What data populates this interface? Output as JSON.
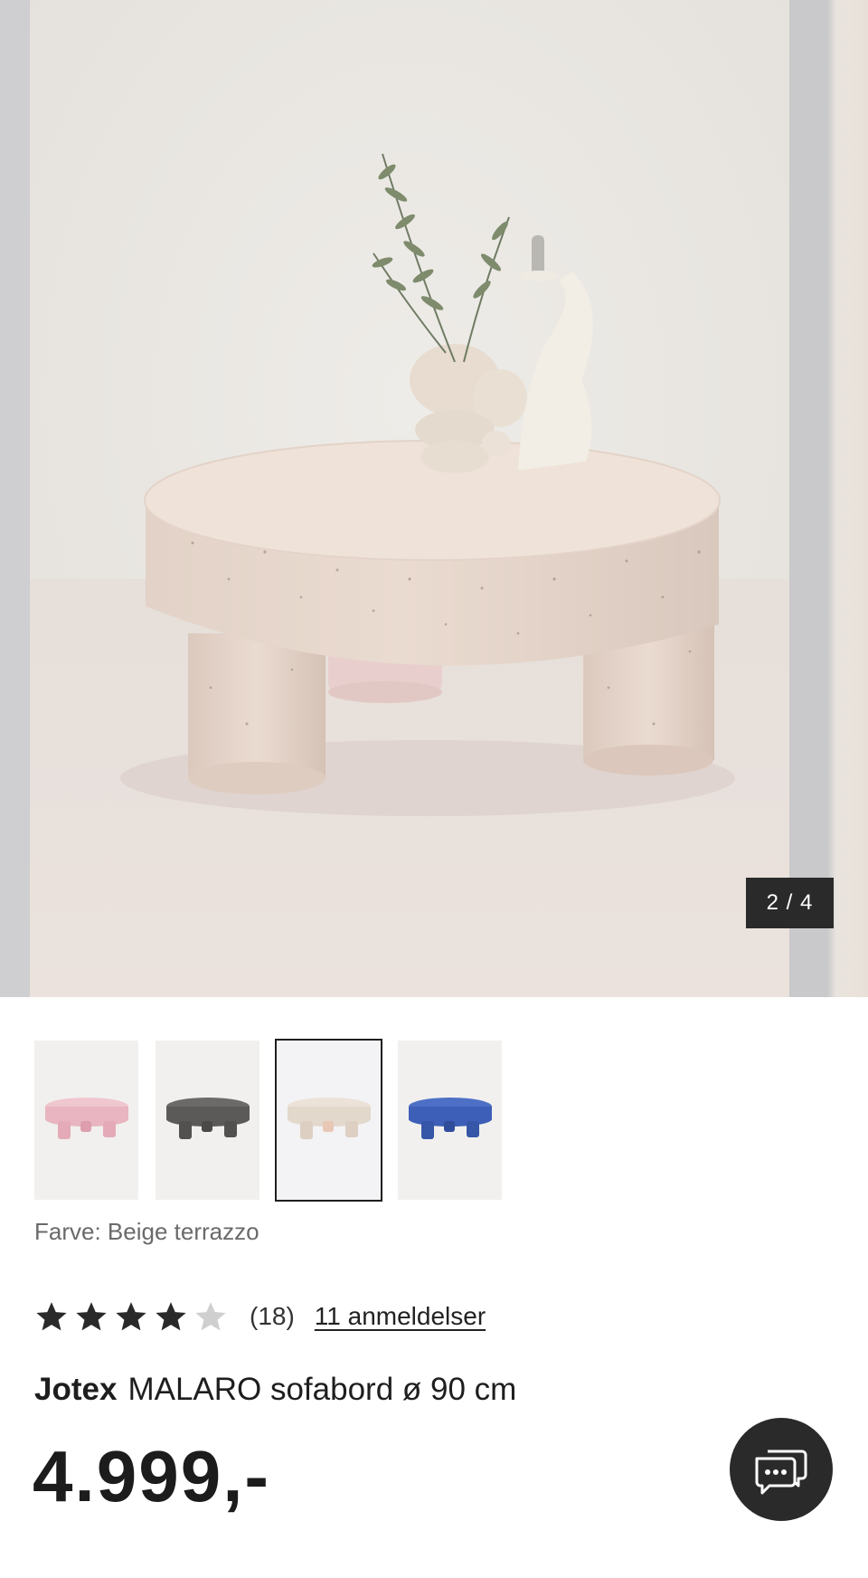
{
  "gallery": {
    "counter": "2 / 4",
    "image_alt": "Beige terrazzo sofabord med vase og lysestage"
  },
  "swatches": [
    {
      "name": "pink",
      "color": "#e8b5c0",
      "selected": false
    },
    {
      "name": "dark-grey",
      "color": "#5b5a58",
      "selected": false
    },
    {
      "name": "beige",
      "color": "#e3d8cc",
      "selected": true
    },
    {
      "name": "blue",
      "color": "#3d5fb8",
      "selected": false
    }
  ],
  "color_label": "Farve: Beige terrazzo",
  "rating": {
    "stars": 4,
    "max_stars": 5,
    "count": "(18)",
    "reviews_link": "11 anmeldelser"
  },
  "product": {
    "brand": "Jotex",
    "name": "MALARO sofabord ø 90 cm",
    "price": "4.999,-"
  },
  "colors": {
    "dark": "#2a2a2a",
    "star_filled": "#2a2a2a",
    "star_empty": "#cfcfcf"
  }
}
